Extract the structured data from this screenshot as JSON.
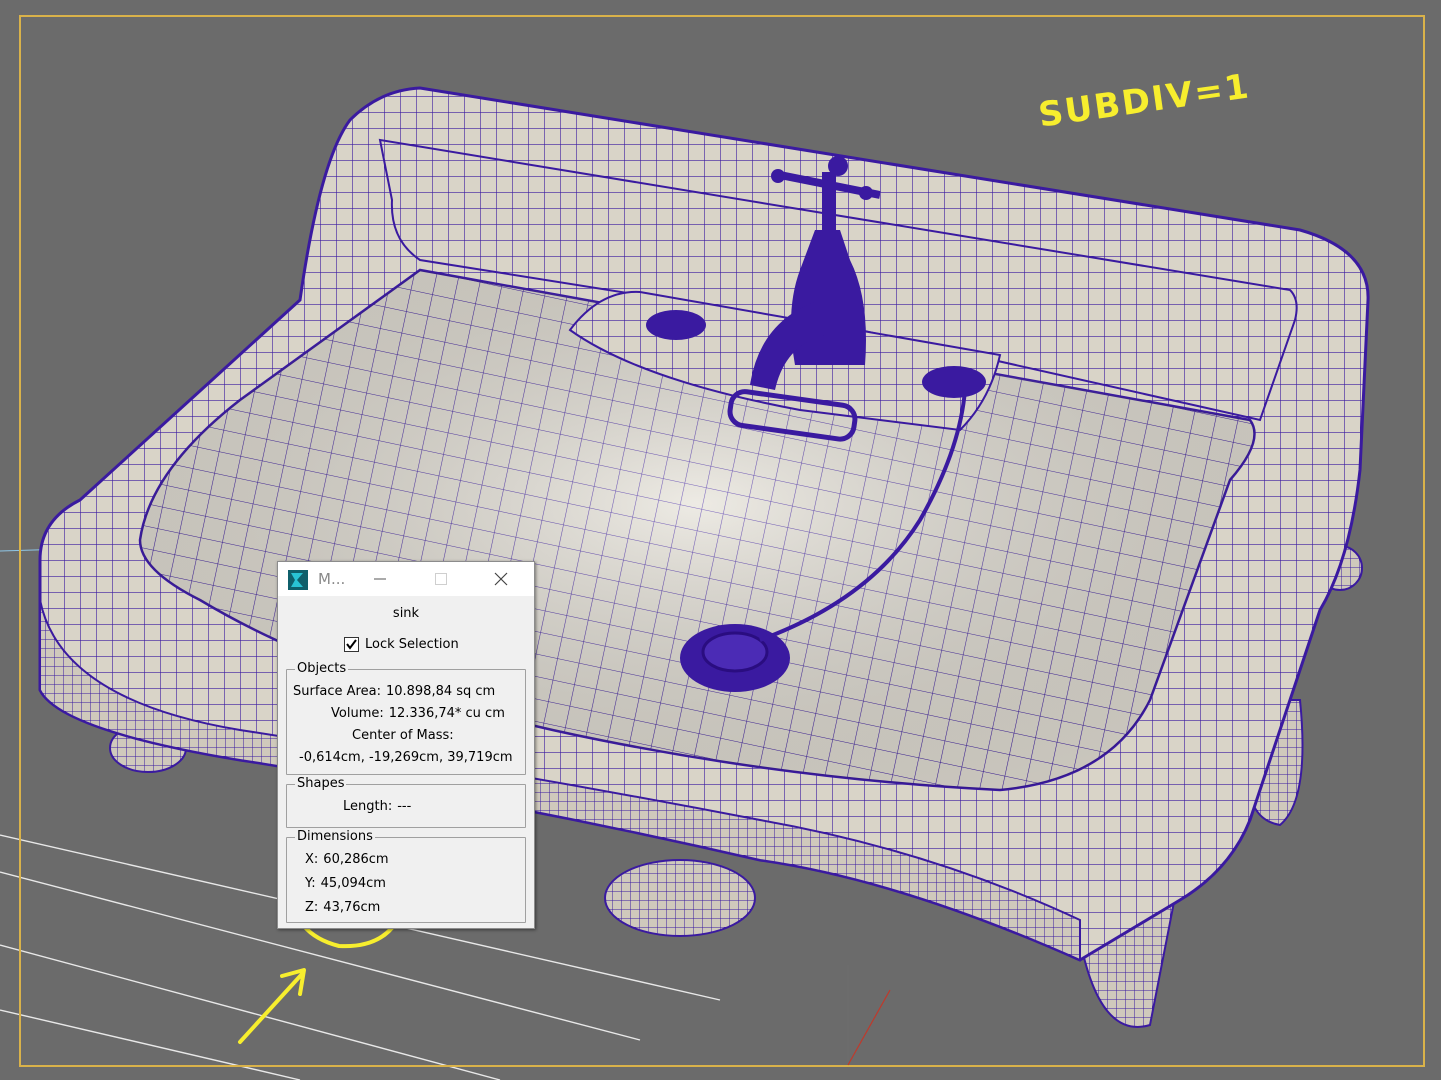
{
  "viewport": {
    "annotation_text": "SUBDIV=1",
    "colors": {
      "background": "#6b6b6b",
      "wireframe": "#3a1aa0",
      "surface": "#d8d3c7",
      "annotation": "#f7ee2e",
      "frame": "#d9b24a"
    }
  },
  "dialog": {
    "title": "M...",
    "app_icon": "3dsmax-app-icon",
    "object_name": "sink",
    "lock_selection_label": "Lock Selection",
    "lock_selection_checked": true,
    "objects": {
      "group_label": "Objects",
      "surface_area_label": "Surface Area:",
      "surface_area_value": "10.898,84 sq cm",
      "volume_label": "Volume:",
      "volume_value": "12.336,74* cu cm",
      "center_of_mass_label": "Center of Mass:",
      "center_of_mass_value": "-0,614cm, -19,269cm, 39,719cm"
    },
    "shapes": {
      "group_label": "Shapes",
      "length_label": "Length:",
      "length_value": "---"
    },
    "dimensions": {
      "group_label": "Dimensions",
      "x_label": "X:",
      "x_value": "60,286cm",
      "y_label": "Y:",
      "y_value": "45,094cm",
      "z_label": "Z:",
      "z_value": "43,76cm"
    }
  }
}
